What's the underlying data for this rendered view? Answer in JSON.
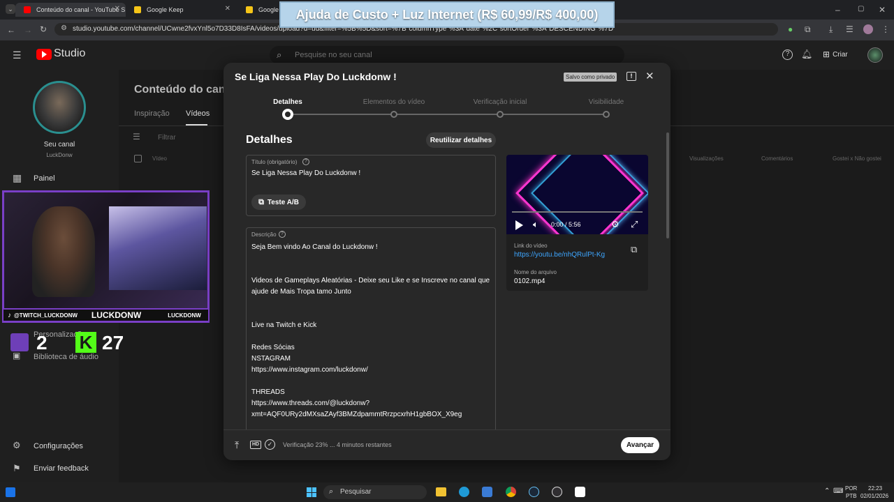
{
  "browser": {
    "tabs": [
      {
        "title": "Conteúdo do canal - YouTube S",
        "color": "#ff0000"
      },
      {
        "title": "Google Keep",
        "color": "#f5c518"
      },
      {
        "title": "Google Keep",
        "color": "#f5c518"
      }
    ],
    "url": "studio.youtube.com/channel/UCwne2fvxYnl5o7D33D8IsFA/videos/upload?d=ud&filter=%5B%5D&sort=%7B\"columnType\"%3A\"date\"%2C\"sortOrder\"%3A\"DESCENDING\"%7D"
  },
  "banner": {
    "text": "Ajuda de Custo + Luz Internet (R$ 60,99/R$ 400,00)"
  },
  "studio": {
    "logo": "Studio",
    "search_placeholder": "Pesquise no seu canal",
    "create_label": "Criar"
  },
  "sidebar": {
    "channel_label": "Seu canal",
    "channel_name": "LuckDonw",
    "items": [
      {
        "label": "Painel"
      },
      {
        "label": "Personalização"
      },
      {
        "label": "Biblioteca de áudio"
      },
      {
        "label": "Configurações"
      },
      {
        "label": "Enviar feedback"
      }
    ]
  },
  "content": {
    "title": "Conteúdo do canal",
    "tabs": [
      "Inspiração",
      "Vídeos"
    ],
    "filter_label": "Filtrar",
    "columns": [
      "Vídeo",
      "Visualizações",
      "Comentários",
      "Gostei x Não gostei"
    ]
  },
  "webcam": {
    "tiktok": "@TWITCH_LUCKDONW",
    "name": "LUCKDONW",
    "name_small": "LUCKDONW",
    "twitch_count": "2",
    "kick_count": "27",
    "kick_letter": "K"
  },
  "modal": {
    "title": "Se Liga Nessa Play Do Luckdonw !",
    "saved_badge": "Salvo como privado",
    "steps": [
      "Detalhes",
      "Elementos do vídeo",
      "Verificação inicial",
      "Visibilidade"
    ],
    "section_title": "Detalhes",
    "reuse_button": "Reutilizar detalhes",
    "title_label": "Título (obrigatório)",
    "title_value": "Se Liga Nessa Play Do Luckdonw !",
    "ab_button": "Teste A/B",
    "description_label": "Descrição",
    "description_lines": [
      "Seja Bem vindo Ao Canal do Luckdonw !",
      "",
      "",
      "Videos de Gameplays Aleatórias - Deixe seu Like e se Inscreve no canal que",
      "ajude de Mais Tropa tamo Junto",
      "",
      "",
      "Live na Twitch e Kick",
      "",
      "Redes Sócias",
      "NSTAGRAM",
      "https://www.instagram.com/luckdonw/",
      "",
      "THREADS",
      "https://www.threads.com/@luckdonw?",
      "xmt=AQF0URy2dMXsaZAyf3BMZdpammtRrzpcxrhH1gbBOX_X9eg"
    ],
    "player_time": "0:00 / 5:56",
    "video_link_label": "Link do vídeo",
    "video_link": "https://youtu.be/nhQRulPt-Kg",
    "filename_label": "Nome do arquivo",
    "filename": "0102.mp4",
    "hd_label": "HD",
    "status": "Verificação 23% ... 4 minutos restantes",
    "next_button": "Avançar"
  },
  "taskbar": {
    "search_label": "Pesquisar",
    "lang_top": "POR",
    "lang_bottom": "PTB",
    "time": "22:23",
    "date": "02/01/2026"
  }
}
